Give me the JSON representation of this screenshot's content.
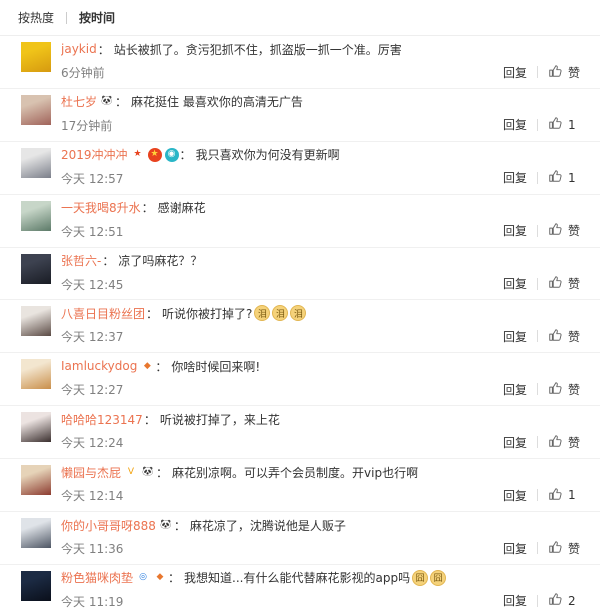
{
  "sort_tabs": {
    "hot": "按热度",
    "time": "按时间"
  },
  "actions": {
    "reply": "回复"
  },
  "comments": [
    {
      "user": "jaykid",
      "badges": [],
      "text": "站长被抓了。贪污犯抓不住，抓盗版一抓一个准。厉害",
      "emojis": [],
      "time": "6分钟前",
      "likes": "赞",
      "avatar_colors": [
        "#f0c419",
        "#d69a10"
      ]
    },
    {
      "user": "杜七岁",
      "badges": [
        {
          "glyph": "🐼",
          "bg": "#ffffff",
          "color": "#333"
        }
      ],
      "text": "麻花挺住 最喜欢你的高清无广告",
      "emojis": [],
      "time": "17分钟前",
      "likes": "1",
      "avatar_colors": [
        "#d8c2b0",
        "#a0635a"
      ]
    },
    {
      "user": "2019冲冲冲",
      "badges": [
        {
          "glyph": "★",
          "bg": "#ffffff",
          "color": "#e8421e"
        },
        {
          "glyph": "★",
          "bg": "#e8421e",
          "color": "#ffd23a"
        },
        {
          "glyph": "◉",
          "bg": "#2ab6c7",
          "color": "#ffffff"
        }
      ],
      "text": "我只喜欢你为何没有更新啊",
      "emojis": [],
      "time": "今天 12:57",
      "likes": "1",
      "avatar_colors": [
        "#e6e6e6",
        "#7b7f8a"
      ]
    },
    {
      "user": "一天我喝8升水",
      "badges": [],
      "text": "感谢麻花",
      "emojis": [],
      "time": "今天 12:51",
      "likes": "赞",
      "avatar_colors": [
        "#c7d6c8",
        "#5c7a68"
      ]
    },
    {
      "user": "张哲六-",
      "badges": [],
      "text": "凉了吗麻花？？",
      "emojis": [],
      "time": "今天 12:45",
      "likes": "赞",
      "avatar_colors": [
        "#3d4250",
        "#191c24"
      ]
    },
    {
      "user": "八喜日目粉丝团",
      "badges": [],
      "text": "听说你被打掉了?",
      "emojis": [
        "泪",
        "泪",
        "泪"
      ],
      "time": "今天 12:37",
      "likes": "赞",
      "avatar_colors": [
        "#e9e4df",
        "#5a4a44"
      ]
    },
    {
      "user": "Iamluckydog",
      "badges": [
        {
          "glyph": "◆",
          "bg": "#ffffff",
          "color": "#e8772e"
        }
      ],
      "text": "你啥时候回来啊!",
      "emojis": [],
      "time": "今天 12:27",
      "likes": "赞",
      "avatar_colors": [
        "#f3e6cf",
        "#c98f4a"
      ]
    },
    {
      "user": "哈哈哈123147",
      "badges": [],
      "text": "听说被打掉了，来上花",
      "emojis": [],
      "time": "今天 12:24",
      "likes": "赞",
      "avatar_colors": [
        "#ece3e1",
        "#3a2f2e"
      ]
    },
    {
      "user": "懒园与杰屁",
      "badges": [
        {
          "glyph": "V",
          "bg": "#ffffff",
          "color": "#f2a20c"
        },
        {
          "glyph": "🐼",
          "bg": "#ffffff",
          "color": "#333"
        }
      ],
      "text": "麻花别凉啊。可以弄个会员制度。开vip也行啊",
      "emojis": [],
      "time": "今天 12:14",
      "likes": "1",
      "avatar_colors": [
        "#e6d3b8",
        "#8c3b2f"
      ]
    },
    {
      "user": "你的小哥哥呀888",
      "badges": [
        {
          "glyph": "🐼",
          "bg": "#ffffff",
          "color": "#333"
        }
      ],
      "text": "麻花凉了，沈腾说他是人贩子",
      "emojis": [],
      "time": "今天 11:36",
      "likes": "赞",
      "avatar_colors": [
        "#dfe3e8",
        "#4d5563"
      ]
    },
    {
      "user": "粉色猫咪肉垫",
      "badges": [
        {
          "glyph": "◎",
          "bg": "#ffffff",
          "color": "#2a7ee0"
        },
        {
          "glyph": "◆",
          "bg": "#ffffff",
          "color": "#e8772e"
        }
      ],
      "text": "我想知道...有什么能代替麻花影视的app吗",
      "emojis": [
        "囧",
        "囧"
      ],
      "time": "今天 11:19",
      "likes": "2",
      "avatar_colors": [
        "#1c2b44",
        "#0a0f1a"
      ]
    }
  ]
}
